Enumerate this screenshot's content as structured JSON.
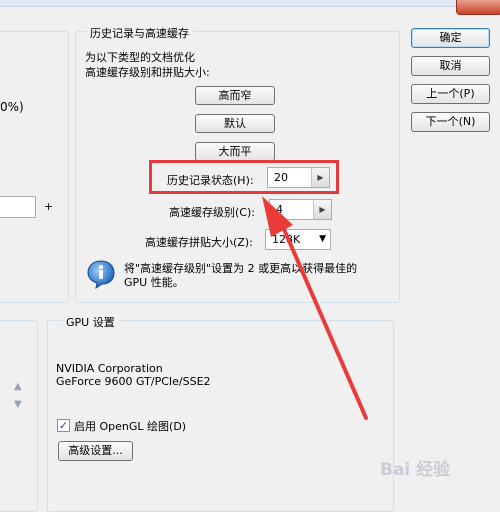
{
  "history_cache": {
    "legend": "历史记录与高速缓存",
    "desc_line1": "为以下类型的文档优化",
    "desc_line2": "高速缓存级别和拼贴大小:",
    "btn_tall_narrow": "高而窄",
    "btn_default": "默认",
    "btn_big_flat": "大而平",
    "history_states_label": "历史记录状态(H):",
    "history_states_value": "20",
    "cache_levels_label": "高速缓存级别(C):",
    "cache_levels_value": "4",
    "tile_size_label": "高速缓存拼贴大小(Z):",
    "tile_size_value": "128K",
    "info_line1": "将\"高速缓存级别\"设置为 2 或更高以获得最佳的",
    "info_line2": "GPU 性能。"
  },
  "dialog_buttons": {
    "ok": "确定",
    "cancel": "取消",
    "prev": "上一个(P)",
    "next": "下一个(N)"
  },
  "gpu": {
    "legend": "GPU 设置",
    "vendor": "NVIDIA Corporation",
    "model": "GeForce 9600 GT/PCIe/SSE2",
    "opengl_label": "启用 OpenGL 绘图(D)",
    "opengl_checked": true,
    "advanced_button": "高级设置..."
  },
  "left_panel": {
    "percent_fragment": "0%)",
    "plus_sign": "+"
  },
  "watermark": "Bai 经验"
}
